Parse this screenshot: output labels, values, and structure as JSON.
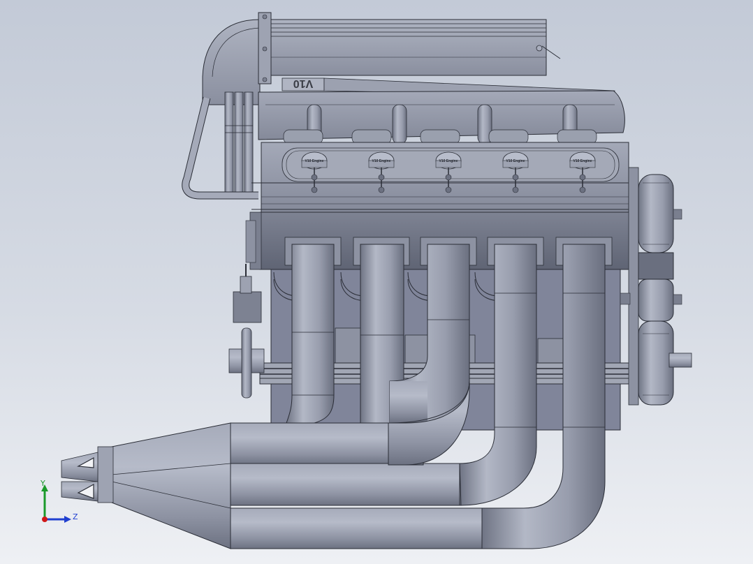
{
  "viewport": {
    "background_top": "#c3cad7",
    "background_bottom": "#eef0f4"
  },
  "model": {
    "name": "V10 engine",
    "badge_text": "V10",
    "valve_cover_label": "V10 Engine",
    "cylinders_per_bank": 5,
    "exhaust_outlets": 2,
    "colors": {
      "body": "#8f94a4",
      "body_light": "#a9aebd",
      "body_dark": "#6b7080",
      "edge": "#2a2d36"
    }
  },
  "triad": {
    "y_label": "Y",
    "z_label": "Z",
    "y_color": "#1a9a2a",
    "z_color": "#1f3fd0",
    "x_color": "#d01818"
  }
}
